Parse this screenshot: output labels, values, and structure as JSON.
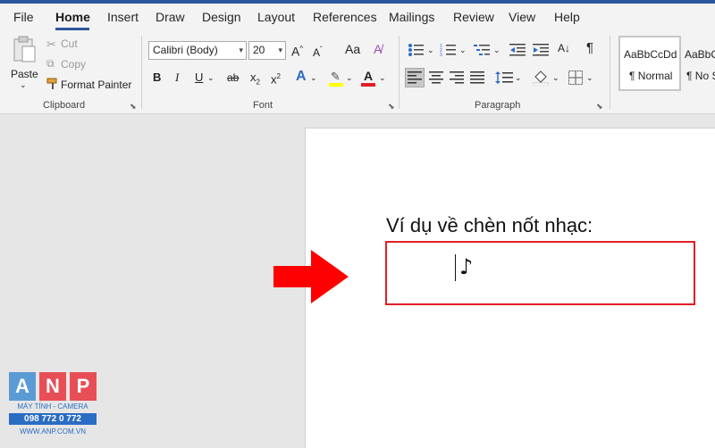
{
  "menu": {
    "tabs": [
      "File",
      "Home",
      "Insert",
      "Draw",
      "Design",
      "Layout",
      "References",
      "Mailings",
      "Review",
      "View",
      "Help"
    ],
    "active": "Home"
  },
  "clipboard": {
    "paste": "Paste",
    "cut": "Cut",
    "copy": "Copy",
    "format_painter": "Format Painter",
    "label": "Clipboard"
  },
  "font": {
    "name": "Calibri (Body)",
    "size": "20",
    "grow": "A",
    "shrink": "A",
    "bold": "B",
    "italic": "I",
    "underline": "U",
    "strike": "ab",
    "subscript": "x",
    "superscript": "x",
    "label": "Font",
    "highlight_color": "#ffff00",
    "font_color": "#e21d26"
  },
  "paragraph": {
    "label": "Paragraph",
    "pilcrow": "¶"
  },
  "styles": {
    "normal_sample": "AaBbCcDd",
    "normal_name": "¶ Normal",
    "nospacing_sample": "AaBbCcDd",
    "nospacing_name": "¶ No Sp"
  },
  "document": {
    "heading": "Ví dụ về chèn nốt nhạc:",
    "symbol": "♪",
    "highlight_color": "#e21d26"
  },
  "logo": {
    "letters": [
      "A",
      "N",
      "P"
    ],
    "subtitle": "MÁY TÍNH - CAMERA",
    "phone": "098 772 0 772",
    "website": "WWW.ANP.COM.VN"
  }
}
